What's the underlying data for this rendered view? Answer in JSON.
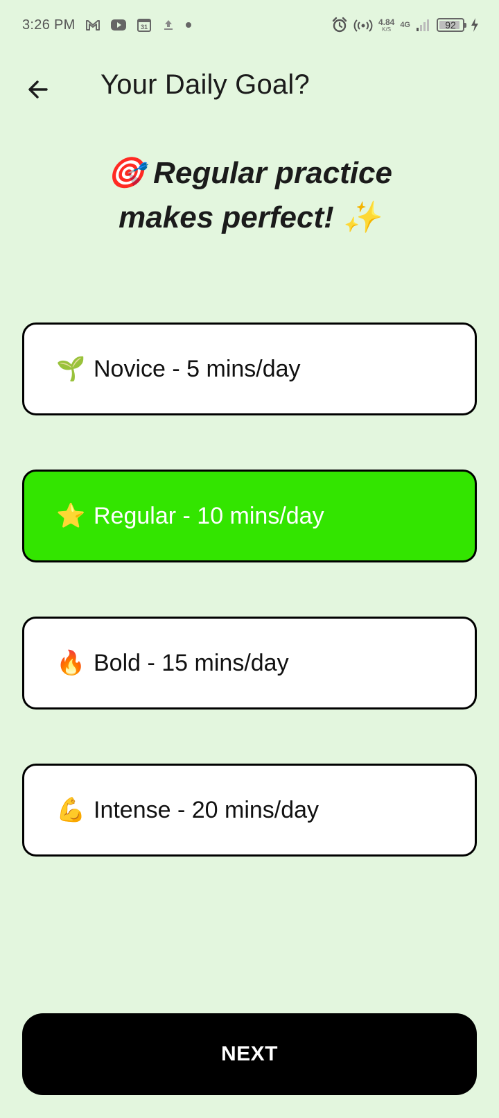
{
  "status_bar": {
    "time": "3:26 PM",
    "left_icons": [
      "gmail-icon",
      "youtube-icon",
      "calendar-icon",
      "upload-icon",
      "dot-icon"
    ],
    "calendar_day": "31",
    "net_speed_value": "4.84",
    "net_speed_unit": "K/S",
    "network_type": "4G",
    "battery_level": "92",
    "battery_fraction": 0.92
  },
  "header": {
    "title": "Your Daily Goal?"
  },
  "headline": {
    "line1_emoji": "🎯",
    "line1": "Regular practice",
    "line2": "makes perfect!",
    "line2_emoji": "✨"
  },
  "options": [
    {
      "emoji": "🌱",
      "label": "Novice - 5 mins/day",
      "selected": false
    },
    {
      "emoji": "⭐",
      "label": "Regular - 10 mins/day",
      "selected": true
    },
    {
      "emoji": "🔥",
      "label": "Bold - 15 mins/day",
      "selected": false
    },
    {
      "emoji": "💪",
      "label": "Intense - 20 mins/day",
      "selected": false
    }
  ],
  "next_button": {
    "label": "NEXT"
  },
  "colors": {
    "background": "#e3f6de",
    "selected": "#33e500",
    "button": "#000000"
  }
}
